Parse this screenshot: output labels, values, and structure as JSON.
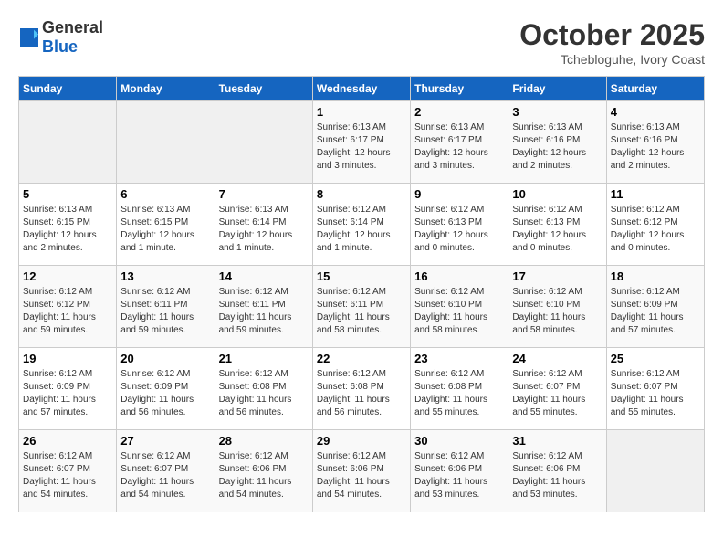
{
  "header": {
    "logo_general": "General",
    "logo_blue": "Blue",
    "month": "October 2025",
    "location": "Tchebloguhe, Ivory Coast"
  },
  "calendar": {
    "days_of_week": [
      "Sunday",
      "Monday",
      "Tuesday",
      "Wednesday",
      "Thursday",
      "Friday",
      "Saturday"
    ],
    "weeks": [
      [
        {
          "day": "",
          "info": ""
        },
        {
          "day": "",
          "info": ""
        },
        {
          "day": "",
          "info": ""
        },
        {
          "day": "1",
          "info": "Sunrise: 6:13 AM\nSunset: 6:17 PM\nDaylight: 12 hours\nand 3 minutes."
        },
        {
          "day": "2",
          "info": "Sunrise: 6:13 AM\nSunset: 6:17 PM\nDaylight: 12 hours\nand 3 minutes."
        },
        {
          "day": "3",
          "info": "Sunrise: 6:13 AM\nSunset: 6:16 PM\nDaylight: 12 hours\nand 2 minutes."
        },
        {
          "day": "4",
          "info": "Sunrise: 6:13 AM\nSunset: 6:16 PM\nDaylight: 12 hours\nand 2 minutes."
        }
      ],
      [
        {
          "day": "5",
          "info": "Sunrise: 6:13 AM\nSunset: 6:15 PM\nDaylight: 12 hours\nand 2 minutes."
        },
        {
          "day": "6",
          "info": "Sunrise: 6:13 AM\nSunset: 6:15 PM\nDaylight: 12 hours\nand 1 minute."
        },
        {
          "day": "7",
          "info": "Sunrise: 6:13 AM\nSunset: 6:14 PM\nDaylight: 12 hours\nand 1 minute."
        },
        {
          "day": "8",
          "info": "Sunrise: 6:12 AM\nSunset: 6:14 PM\nDaylight: 12 hours\nand 1 minute."
        },
        {
          "day": "9",
          "info": "Sunrise: 6:12 AM\nSunset: 6:13 PM\nDaylight: 12 hours\nand 0 minutes."
        },
        {
          "day": "10",
          "info": "Sunrise: 6:12 AM\nSunset: 6:13 PM\nDaylight: 12 hours\nand 0 minutes."
        },
        {
          "day": "11",
          "info": "Sunrise: 6:12 AM\nSunset: 6:12 PM\nDaylight: 12 hours\nand 0 minutes."
        }
      ],
      [
        {
          "day": "12",
          "info": "Sunrise: 6:12 AM\nSunset: 6:12 PM\nDaylight: 11 hours\nand 59 minutes."
        },
        {
          "day": "13",
          "info": "Sunrise: 6:12 AM\nSunset: 6:11 PM\nDaylight: 11 hours\nand 59 minutes."
        },
        {
          "day": "14",
          "info": "Sunrise: 6:12 AM\nSunset: 6:11 PM\nDaylight: 11 hours\nand 59 minutes."
        },
        {
          "day": "15",
          "info": "Sunrise: 6:12 AM\nSunset: 6:11 PM\nDaylight: 11 hours\nand 58 minutes."
        },
        {
          "day": "16",
          "info": "Sunrise: 6:12 AM\nSunset: 6:10 PM\nDaylight: 11 hours\nand 58 minutes."
        },
        {
          "day": "17",
          "info": "Sunrise: 6:12 AM\nSunset: 6:10 PM\nDaylight: 11 hours\nand 58 minutes."
        },
        {
          "day": "18",
          "info": "Sunrise: 6:12 AM\nSunset: 6:09 PM\nDaylight: 11 hours\nand 57 minutes."
        }
      ],
      [
        {
          "day": "19",
          "info": "Sunrise: 6:12 AM\nSunset: 6:09 PM\nDaylight: 11 hours\nand 57 minutes."
        },
        {
          "day": "20",
          "info": "Sunrise: 6:12 AM\nSunset: 6:09 PM\nDaylight: 11 hours\nand 56 minutes."
        },
        {
          "day": "21",
          "info": "Sunrise: 6:12 AM\nSunset: 6:08 PM\nDaylight: 11 hours\nand 56 minutes."
        },
        {
          "day": "22",
          "info": "Sunrise: 6:12 AM\nSunset: 6:08 PM\nDaylight: 11 hours\nand 56 minutes."
        },
        {
          "day": "23",
          "info": "Sunrise: 6:12 AM\nSunset: 6:08 PM\nDaylight: 11 hours\nand 55 minutes."
        },
        {
          "day": "24",
          "info": "Sunrise: 6:12 AM\nSunset: 6:07 PM\nDaylight: 11 hours\nand 55 minutes."
        },
        {
          "day": "25",
          "info": "Sunrise: 6:12 AM\nSunset: 6:07 PM\nDaylight: 11 hours\nand 55 minutes."
        }
      ],
      [
        {
          "day": "26",
          "info": "Sunrise: 6:12 AM\nSunset: 6:07 PM\nDaylight: 11 hours\nand 54 minutes."
        },
        {
          "day": "27",
          "info": "Sunrise: 6:12 AM\nSunset: 6:07 PM\nDaylight: 11 hours\nand 54 minutes."
        },
        {
          "day": "28",
          "info": "Sunrise: 6:12 AM\nSunset: 6:06 PM\nDaylight: 11 hours\nand 54 minutes."
        },
        {
          "day": "29",
          "info": "Sunrise: 6:12 AM\nSunset: 6:06 PM\nDaylight: 11 hours\nand 54 minutes."
        },
        {
          "day": "30",
          "info": "Sunrise: 6:12 AM\nSunset: 6:06 PM\nDaylight: 11 hours\nand 53 minutes."
        },
        {
          "day": "31",
          "info": "Sunrise: 6:12 AM\nSunset: 6:06 PM\nDaylight: 11 hours\nand 53 minutes."
        },
        {
          "day": "",
          "info": ""
        }
      ]
    ]
  }
}
